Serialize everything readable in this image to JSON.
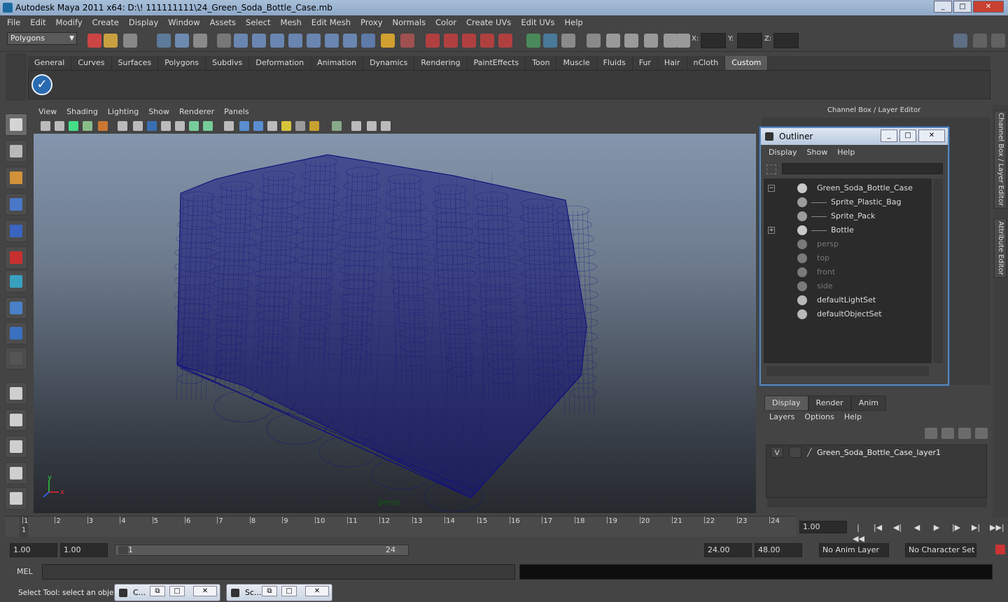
{
  "window": {
    "title": "Autodesk Maya 2011 x64: D:\\! 111111111\\24_Green_Soda_Bottle_Case.mb",
    "min": "_",
    "max": "□",
    "close": "✕"
  },
  "menu": [
    "File",
    "Edit",
    "Modify",
    "Create",
    "Display",
    "Window",
    "Assets",
    "Select",
    "Mesh",
    "Edit Mesh",
    "Proxy",
    "Normals",
    "Color",
    "Create UVs",
    "Edit UVs",
    "Help"
  ],
  "toolbar": {
    "mode": "Polygons",
    "x_label": "X:",
    "y_label": "Y:",
    "z_label": "Z:"
  },
  "shelf": {
    "tabs": [
      "General",
      "Curves",
      "Surfaces",
      "Polygons",
      "Subdivs",
      "Deformation",
      "Animation",
      "Dynamics",
      "Rendering",
      "PaintEffects",
      "Toon",
      "Muscle",
      "Fluids",
      "Fur",
      "Hair",
      "nCloth",
      "Custom"
    ],
    "active": "Custom",
    "checkmark": "✓"
  },
  "viewport": {
    "menu": [
      "View",
      "Shading",
      "Lighting",
      "Show",
      "Renderer",
      "Panels"
    ],
    "camera_label": "persp",
    "axis_x": "x",
    "axis_y": "y",
    "wire_color": "#14147a"
  },
  "channel_box": {
    "header": "Channel Box / Layer Editor",
    "side_tab_1": "Channel Box / Layer Editor",
    "side_tab_2": "Attribute Editor"
  },
  "outliner": {
    "title": "Outliner",
    "menu": [
      "Display",
      "Show",
      "Help"
    ],
    "items": [
      {
        "label": "Green_Soda_Bottle_Case",
        "icon": "mesh-icon",
        "expand": "−",
        "dim": false,
        "indent": 0
      },
      {
        "label": "Sprite_Plastic_Bag",
        "icon": "group-icon",
        "expand": "",
        "dim": false,
        "indent": 1
      },
      {
        "label": "Sprite_Pack",
        "icon": "group-icon",
        "expand": "",
        "dim": false,
        "indent": 1
      },
      {
        "label": "Bottle",
        "icon": "mesh-icon",
        "expand": "+",
        "dim": false,
        "indent": 1
      },
      {
        "label": "persp",
        "icon": "camera-icon",
        "expand": "",
        "dim": true,
        "indent": 0
      },
      {
        "label": "top",
        "icon": "camera-icon",
        "expand": "",
        "dim": true,
        "indent": 0
      },
      {
        "label": "front",
        "icon": "camera-icon",
        "expand": "",
        "dim": true,
        "indent": 0
      },
      {
        "label": "side",
        "icon": "camera-icon",
        "expand": "",
        "dim": true,
        "indent": 0
      },
      {
        "label": "defaultLightSet",
        "icon": "set-icon",
        "expand": "",
        "dim": false,
        "indent": 0
      },
      {
        "label": "defaultObjectSet",
        "icon": "set-icon",
        "expand": "",
        "dim": false,
        "indent": 0
      }
    ]
  },
  "layer_editor": {
    "tabs": [
      "Display",
      "Render",
      "Anim"
    ],
    "active": "Display",
    "menu": [
      "Layers",
      "Options",
      "Help"
    ],
    "layer": {
      "visible": "V",
      "name": "Green_Soda_Bottle_Case_layer1"
    }
  },
  "timeline": {
    "ticks": [
      "1",
      "2",
      "3",
      "4",
      "5",
      "6",
      "7",
      "8",
      "9",
      "10",
      "11",
      "12",
      "13",
      "14",
      "15",
      "16",
      "17",
      "18",
      "19",
      "20",
      "21",
      "22",
      "23",
      "24"
    ],
    "current": "1",
    "current_field": "1.00"
  },
  "range": {
    "start": "1.00",
    "start2": "1.00",
    "slider_start": "1",
    "slider_end": "24",
    "end": "24.00",
    "end2": "48.00",
    "anim_layer": "No Anim Layer",
    "char_set": "No Character Set"
  },
  "mel": {
    "label": "MEL"
  },
  "status": {
    "text": "Select Tool: select an object",
    "task1": "C...",
    "task2": "Sc..."
  }
}
